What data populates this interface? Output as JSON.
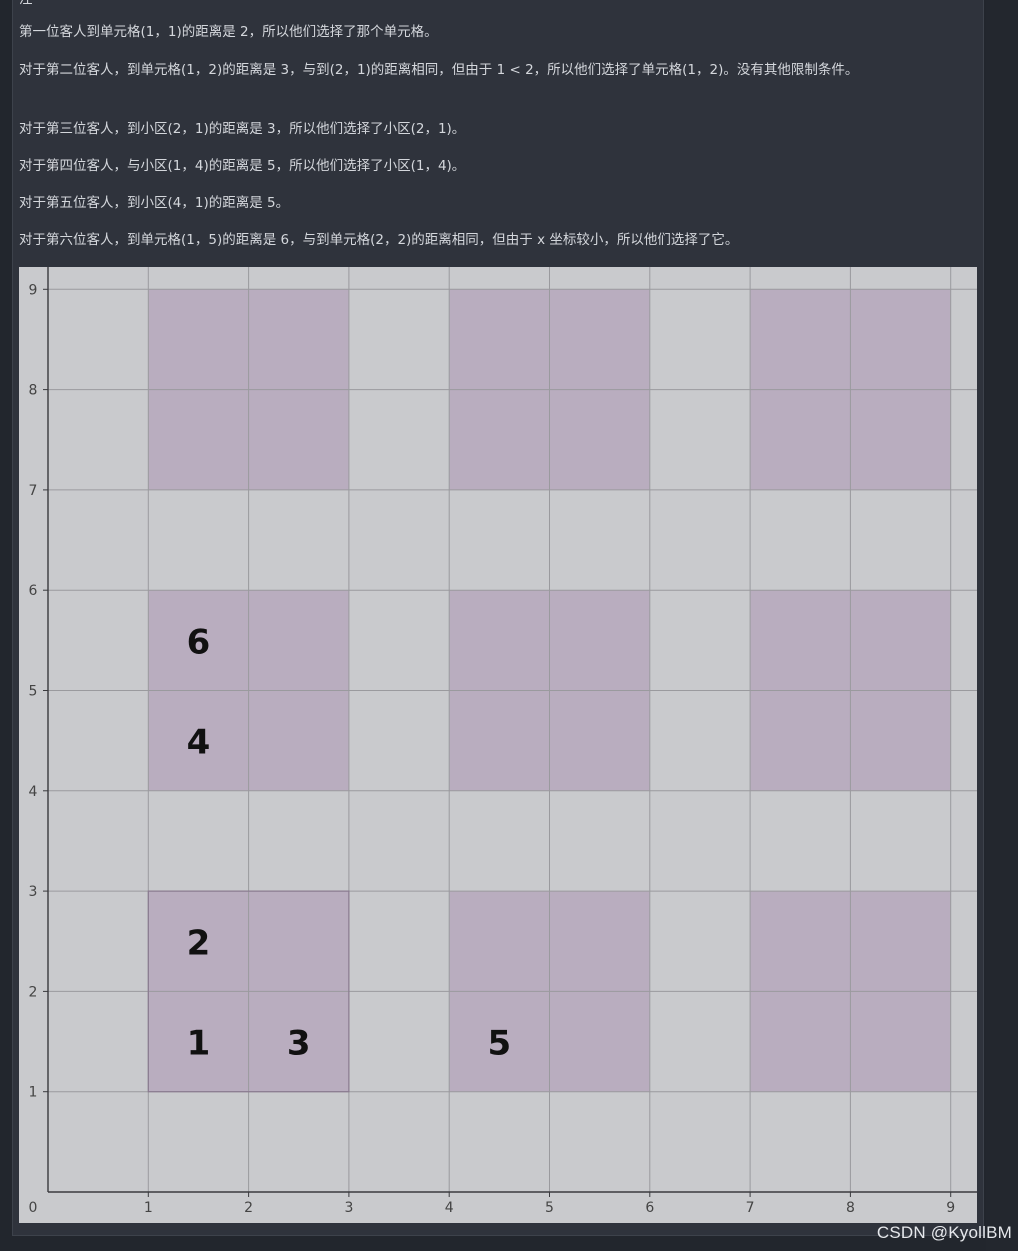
{
  "article": {
    "cut_line": "注",
    "paragraphs": [
      "第一位客人到单元格(1，1)的距离是 2，所以他们选择了那个单元格。",
      "对于第二位客人，到单元格(1，2)的距离是 3，与到(2，1)的距离相同，但由于 1 < 2，所以他们选择了单元格(1，2)。没有其他限制条件。",
      "对于第三位客人，到小区(2，1)的距离是 3，所以他们选择了小区(2，1)。",
      "对于第四位客人，与小区(1，4)的距离是 5，所以他们选择了小区(1，4)。",
      "对于第五位客人，到小区(4，1)的距离是 5。",
      "对于第六位客人，到单元格(1，5)的距离是 6，与到单元格(2，2)的距离相同，但由于 x 坐标较小，所以他们选择了它。"
    ]
  },
  "chart_data": {
    "type": "heatmap",
    "x_ticks": [
      "0",
      "1",
      "2",
      "3",
      "4",
      "5",
      "6",
      "7",
      "8",
      "9"
    ],
    "y_ticks": [
      "1",
      "2",
      "3",
      "4",
      "5",
      "6",
      "7",
      "8",
      "9"
    ],
    "xlim": [
      0,
      9
    ],
    "ylim": [
      0,
      9
    ],
    "grid": true,
    "background_color": "#c9cacd",
    "cell_color": "#b9adbf",
    "cell_blocks": [
      {
        "x": [
          1,
          3
        ],
        "y": [
          7,
          9
        ]
      },
      {
        "x": [
          4,
          6
        ],
        "y": [
          7,
          9
        ]
      },
      {
        "x": [
          7,
          9
        ],
        "y": [
          7,
          9
        ]
      },
      {
        "x": [
          1,
          3
        ],
        "y": [
          4,
          6
        ]
      },
      {
        "x": [
          4,
          6
        ],
        "y": [
          4,
          6
        ]
      },
      {
        "x": [
          7,
          9
        ],
        "y": [
          4,
          6
        ]
      },
      {
        "x": [
          1,
          3
        ],
        "y": [
          1,
          3
        ]
      },
      {
        "x": [
          4,
          6
        ],
        "y": [
          1,
          3
        ]
      },
      {
        "x": [
          7,
          9
        ],
        "y": [
          1,
          3
        ]
      }
    ],
    "outlined_block": {
      "x": [
        1,
        3
      ],
      "y": [
        1,
        3
      ]
    },
    "guests": [
      {
        "label": "1",
        "x": 1,
        "y": 1
      },
      {
        "label": "2",
        "x": 1,
        "y": 2
      },
      {
        "label": "3",
        "x": 2,
        "y": 1
      },
      {
        "label": "4",
        "x": 1,
        "y": 4
      },
      {
        "label": "5",
        "x": 4,
        "y": 1
      },
      {
        "label": "6",
        "x": 1,
        "y": 5
      }
    ]
  },
  "watermark": "CSDN @KyollBM"
}
